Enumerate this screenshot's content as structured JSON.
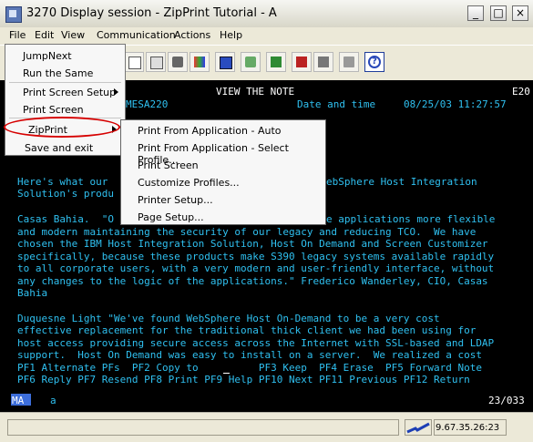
{
  "window": {
    "title": "3270 Display session - ZipPrint Tutorial - A",
    "minimize": "_",
    "maximize": "□",
    "close": "×"
  },
  "menubar": [
    "File",
    "Edit",
    "View",
    "Communication",
    "Actions",
    "Help"
  ],
  "toolbar_icons": [
    "copy-icon",
    "paste-icon",
    "print-icon",
    "color-palette-icon",
    "keyboard-icon",
    "record-macro-icon",
    "play-macro-icon",
    "stop-macro-icon",
    "macro-icon",
    "clipboard-icon",
    "help-icon"
  ],
  "file_menu": [
    {
      "label": "JumpNext"
    },
    {
      "label": "Run the Same"
    },
    {
      "label": "Print Screen Setup",
      "submenu": true
    },
    {
      "label": "Print Screen"
    },
    {
      "label": "ZipPrint",
      "submenu": true,
      "highlighted": true
    },
    {
      "label": "Save and exit"
    }
  ],
  "zipprint_submenu": [
    "Print From Application - Auto",
    "Print From Application - Select Profile...",
    "Print Screen",
    "Customize Profiles...",
    "Printer Setup...",
    "Page Setup..."
  ],
  "terminal": {
    "header_title": "VIEW THE NOTE",
    "header_code": "E20",
    "system": "MESA220",
    "date_label": "Date and time",
    "date_value": "08/25/03 11:27:57",
    "lines": [
      "Here's what our",
      "Solution's produ",
      "",
      "Casas Bahia.  \"O",
      "and modern maintaining the security of our legacy and reducing TCO.  We have",
      "chosen the IBM Host Integration Solution, Host On Demand and Screen Customizer",
      "specifically, because these products make S390 legacy systems available rapidly",
      "to all corporate users, with a very modern and user-friendly interface, without",
      "any changes to the logic of the applications.\" Frederico Wanderley, CIO, Casas",
      "Bahia",
      "",
      "Duquesne Light \"We've found WebSphere Host On-Demand to be a very cost",
      "effective replacement for the traditional thick client we had been using for",
      "host access providing secure access across the Internet with SSL-based and LDAP",
      "support.  Host On Demand was easy to install on a server.  We realized a cost"
    ],
    "partial_right_line1": "ebSphere Host Integration",
    "partial_right_line2": "e applications more flexible",
    "pf_line1": "PF1 Alternate PFs  PF2 Copy to          PF3 Keep  PF4 Erase  PF5 Forward Note",
    "pf_line2": "PF6 Reply PF7 Resend PF8 Print PF9 Help PF10 Next PF11 Previous PF12 Return"
  },
  "status": {
    "left_badge": "MA",
    "left_text": "a",
    "position": "23/033",
    "ip": "9.67.35.26:23"
  }
}
